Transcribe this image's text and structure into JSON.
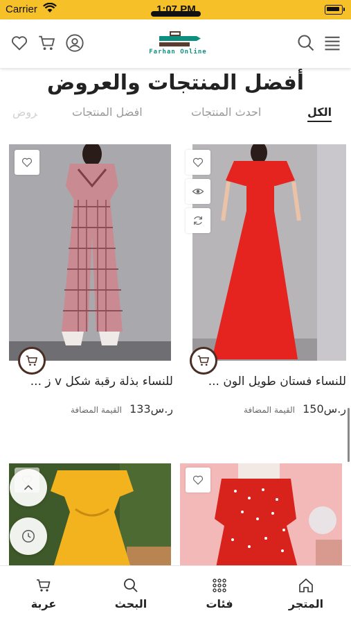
{
  "status_bar": {
    "carrier": "Carrier",
    "time": "1:07 PM"
  },
  "header": {
    "logo_text": "Farhan Online"
  },
  "section": {
    "title": "أفضل المنتجات والعروض",
    "tabs": [
      "الكل",
      "احدث المنتجات",
      "افضل المنتجات",
      "عروض"
    ]
  },
  "products": [
    {
      "name": "للنساء فستان طويل الون ...",
      "price": "ر.س150",
      "vat_label": "القيمة المضافة",
      "colors": {
        "bg": "#b7b5b8",
        "item": "#e5231f"
      }
    },
    {
      "name": "للنساء بذلة رقبة شكل v ز ...",
      "price": "ر.س133",
      "vat_label": "القيمة المضافة",
      "colors": {
        "bg": "#a9a9ad",
        "item": "#c98a92"
      }
    },
    {
      "colors": {
        "bg": "#f3b9b9",
        "item": "#d8231c"
      }
    },
    {
      "colors": {
        "bg": "#3f5a2a",
        "item": "#f2b31e"
      }
    }
  ],
  "bottom_nav": {
    "store": "المتجر",
    "categories": "فئات",
    "search": "البحث",
    "cart": "عربة"
  },
  "colors": {
    "accent": "#f5c028",
    "cart_border": "#4a2e25",
    "logo_teal": "#0d8f80",
    "logo_brown": "#5a3b2e"
  }
}
